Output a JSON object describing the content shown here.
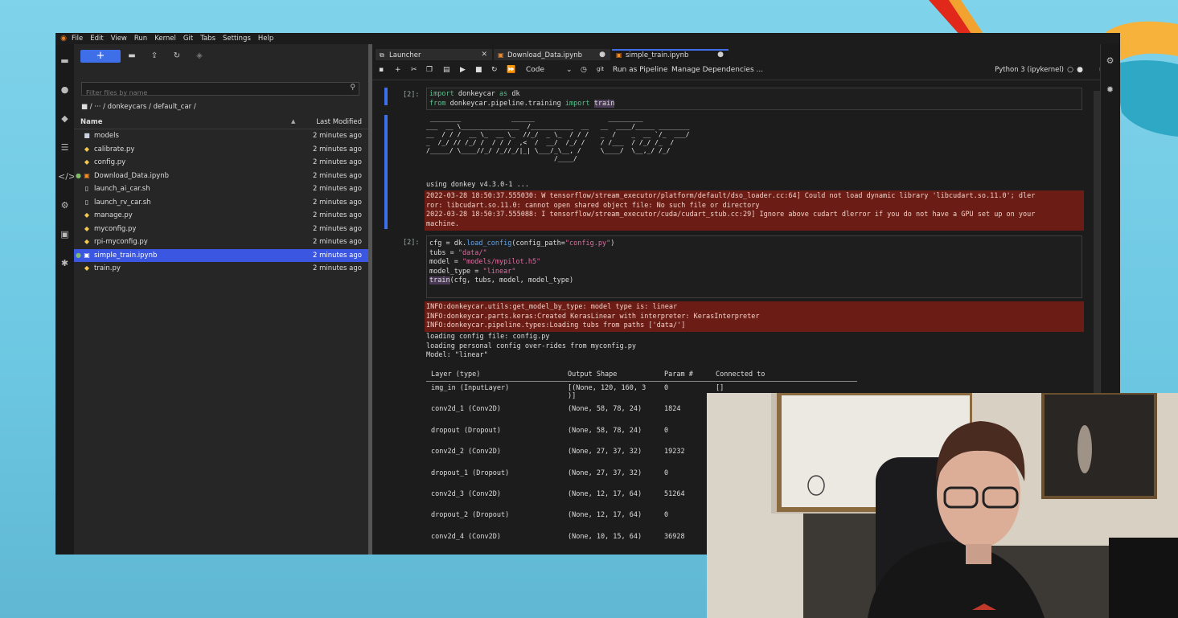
{
  "menubar": {
    "items": [
      "File",
      "Edit",
      "View",
      "Run",
      "Kernel",
      "Git",
      "Tabs",
      "Settings",
      "Help"
    ]
  },
  "activitybar": {
    "icons": [
      "folder-icon",
      "running-icon",
      "git-icon",
      "toc-icon",
      "code-icon",
      "property-inspector-icon",
      "extension-manager-icon",
      "puzzle-icon"
    ]
  },
  "filebrowser": {
    "new_label": "+",
    "filter_placeholder": "Filter files by name",
    "breadcrumb": "/ ··· / donkeycars / default_car /",
    "col_name": "Name",
    "col_modified": "Last Modified",
    "files": [
      {
        "name": "models",
        "icon": "folder-icon",
        "modified": "2 minutes ago"
      },
      {
        "name": "calibrate.py",
        "icon": "python-icon",
        "modified": "2 minutes ago"
      },
      {
        "name": "config.py",
        "icon": "python-icon",
        "modified": "2 minutes ago"
      },
      {
        "name": "Download_Data.ipynb",
        "icon": "notebook-icon",
        "modified": "2 minutes ago"
      },
      {
        "name": "launch_ai_car.sh",
        "icon": "file-icon",
        "modified": "2 minutes ago"
      },
      {
        "name": "launch_rv_car.sh",
        "icon": "file-icon",
        "modified": "2 minutes ago"
      },
      {
        "name": "manage.py",
        "icon": "python-icon",
        "modified": "2 minutes ago"
      },
      {
        "name": "myconfig.py",
        "icon": "python-icon",
        "modified": "2 minutes ago"
      },
      {
        "name": "rpi-myconfig.py",
        "icon": "python-icon",
        "modified": "2 minutes ago"
      },
      {
        "name": "simple_train.ipynb",
        "icon": "notebook-icon",
        "modified": "2 minutes ago"
      },
      {
        "name": "train.py",
        "icon": "python-icon",
        "modified": "2 minutes ago"
      }
    ]
  },
  "tabs": [
    {
      "label": "Launcher",
      "close": "✕"
    },
    {
      "label": "Download_Data.ipynb",
      "close": "●"
    },
    {
      "label": "simple_train.ipynb",
      "close": "●"
    }
  ],
  "nbtoolbar": {
    "cell_type": "Code",
    "run_pipeline": "Run as Pipeline",
    "manage_deps": "Manage Dependencies ...",
    "kernel": "Python 3 (ipykernel)"
  },
  "cell1": {
    "prompt": "[2]:",
    "ascii_art": " ________             ______                   _________              \n___  __ \\_______________  /___________  __   __  ____/_____ ________\n__  / / /  __ \\_  __ \\_  //_/  _ \\_  / / /   _  /    _  __ `/_  ___/\n_  /_/ // /_/ /  / / /  ,<  /  __/  /_/ /    / /___  / /_/ /_  /    \n/_____/ \\____//_/ /_//_/|_| \\___/_\\__, /     \\____/  \\__,_/ /_/     \n                                 /____/                              ",
    "stdout1": "using donkey v4.3.0-1 ...",
    "stderr": [
      "2022-03-28 18:50:37.555030: W tensorflow/stream_executor/platform/default/dso_loader.cc:64] Could not load dynamic library 'libcudart.so.11.0'; dler",
      "ror: libcudart.so.11.0: cannot open shared object file: No such file or directory",
      "2022-03-28 18:50:37.555088: I tensorflow/stream_executor/cuda/cudart_stub.cc:29] Ignore above cudart dlerror if you do not have a GPU set up on your",
      "machine."
    ]
  },
  "cell2": {
    "prompt": "[2]:",
    "stderr": [
      "INFO:donkeycar.utils:get_model_by_type: model type is: linear",
      "INFO:donkeycar.parts.keras:Created KerasLinear with interpreter: KerasInterpreter",
      "INFO:donkeycar.pipeline.types:Loading tubs from paths ['data/']"
    ],
    "stdout": [
      "loading config file: config.py",
      "loading personal config over-rides from myconfig.py",
      "Model: \"linear\""
    ]
  },
  "summary": {
    "headers": [
      "Layer (type)",
      "Output Shape",
      "Param #",
      "Connected to"
    ],
    "rows": [
      [
        "img_in (InputLayer)",
        "[(None, 120, 160, 3",
        "0",
        "[]"
      ],
      [
        "conv2d_1 (Conv2D)",
        "(None, 58, 78, 24)",
        "1824",
        ""
      ],
      [
        "dropout (Dropout)",
        "(None, 58, 78, 24)",
        "0",
        ""
      ],
      [
        "conv2d_2 (Conv2D)",
        "(None, 27, 37, 32)",
        "19232",
        ""
      ],
      [
        "dropout_1 (Dropout)",
        "(None, 27, 37, 32)",
        "0",
        ""
      ],
      [
        "conv2d_3 (Conv2D)",
        "(None, 12, 17, 64)",
        "51264",
        ""
      ],
      [
        "dropout_2 (Dropout)",
        "(None, 12, 17, 64)",
        "0",
        ""
      ],
      [
        "conv2d_4 (Conv2D)",
        "(None, 10, 15, 64)",
        "36928",
        ""
      ]
    ],
    "cont": ")]"
  },
  "colors": {
    "accent": "#3e6fe8",
    "stderr_bg": "#6b1d15",
    "background": "#7fd3ea"
  }
}
